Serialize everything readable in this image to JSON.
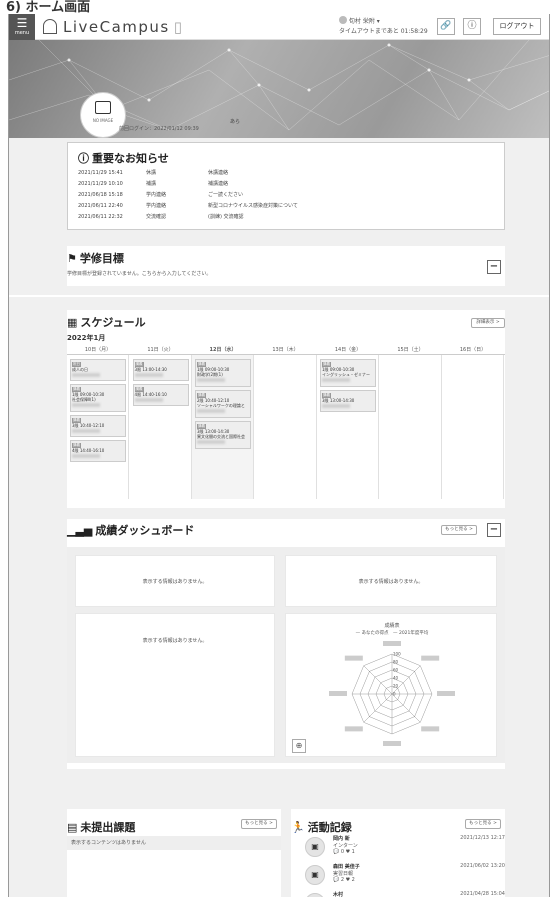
{
  "caption": "6) ホーム画面",
  "header": {
    "menu_label": "menu",
    "app_name": "LiveCampus",
    "user_name": "旬村 栄附 ▾",
    "timeout_text": "タイムアウトまであと 01:58:29",
    "logout_label": "ログアウト"
  },
  "profile": {
    "no_image_label": "NO IMAGE",
    "name": "あら",
    "last_login": "前回ログイン：2022/01/12 09:39"
  },
  "notices": {
    "title": "重要なお知らせ",
    "rows": [
      {
        "date": "2021/11/29 15:41",
        "category": "休講",
        "text": "休講連絡"
      },
      {
        "date": "2021/11/29 10:10",
        "category": "補講",
        "text": "補講連絡"
      },
      {
        "date": "2021/06/18 15:18",
        "category": "学内連絡",
        "text": "ご一読ください"
      },
      {
        "date": "2021/06/11 22:40",
        "category": "学内連絡",
        "text": "新型コロナウイルス感染症対策について"
      },
      {
        "date": "2021/06/11 22:32",
        "category": "交流確認",
        "text": "(訓練) 交流確認"
      }
    ]
  },
  "goal": {
    "title": "学修目標",
    "message": "学修目標が登録されていません。こちらから入力してください。"
  },
  "schedule": {
    "title": "スケジュール",
    "month": "2022年1月",
    "more_label": "詳細表示 >",
    "days": [
      {
        "label": "10日（月）",
        "events": [
          {
            "tag": "祝日",
            "time": "成人の日"
          },
          {
            "tag": "講義",
            "time": "1限 09:00-10:30",
            "name": "社会保障Ⅱ(1)"
          },
          {
            "tag": "講義",
            "time": "3限 10:40-12:10"
          },
          {
            "tag": "講義",
            "time": "4限 14:40-16:10"
          }
        ]
      },
      {
        "label": "11日（火）",
        "events": [
          {
            "tag": "講義",
            "time": "3限 13:00-14:30"
          },
          {
            "tag": "講義",
            "time": "4限 14:40-16:10"
          }
        ]
      },
      {
        "label": "12日（水）",
        "events": [
          {
            "tag": "講義",
            "time": "1限 09:00-10:30",
            "name": "財政学(2期(1)"
          },
          {
            "tag": "講義",
            "time": "2限 10:40-12:10",
            "name": "ソーシャルワークの理論と"
          },
          {
            "tag": "講義",
            "time": "3限 13:00-14:30",
            "name": "異文化間の交流と国際社会"
          }
        ]
      },
      {
        "label": "13日（木）",
        "events": []
      },
      {
        "label": "14日（金）",
        "events": [
          {
            "tag": "講義",
            "time": "1限 09:00-10:30",
            "name": "イングリッシュ・ゼミナー"
          },
          {
            "tag": "講義",
            "time": "3限 13:00-14:30"
          }
        ]
      },
      {
        "label": "15日（土）",
        "events": []
      },
      {
        "label": "16日（日）",
        "events": []
      }
    ]
  },
  "dashboard": {
    "title": "成績ダッシュボード",
    "more_label": "もっと見る >",
    "empty_text": "表示する情報はありません。",
    "radar_title": "成績表",
    "legend_a": "あなたの得点",
    "legend_b": "2021年度平均",
    "radar_ticks": [
      "100",
      "80",
      "60",
      "40",
      "20",
      "0"
    ]
  },
  "pending": {
    "title": "未提出課題",
    "more_label": "もっと見る >",
    "empty_text": "表示するコンテンツはありません"
  },
  "activity": {
    "title": "活動記録",
    "more_label": "もっと見る >",
    "items": [
      {
        "name": "岡内 新",
        "type": "インターン",
        "comments": "0",
        "likes": "1",
        "date": "2021/12/13 12:17"
      },
      {
        "name": "森田 美佳子",
        "type": "実習日報",
        "comments": "2",
        "likes": "2",
        "date": "2021/06/02 13:20"
      },
      {
        "name": "木村",
        "type": "",
        "comments": "",
        "likes": "",
        "date": "2021/04/28 15:04"
      }
    ]
  }
}
